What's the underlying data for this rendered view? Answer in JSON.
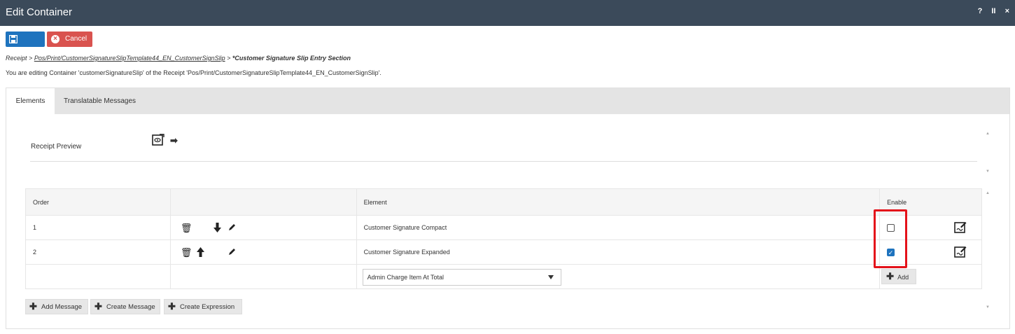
{
  "window": {
    "title": "Edit Container",
    "controls": [
      "?",
      "II",
      "×"
    ]
  },
  "toolbar": {
    "cancel_label": "Cancel"
  },
  "breadcrumb": {
    "root": "Receipt",
    "sep": ">",
    "link": "Pos/Print/CustomerSignatureSlipTemplate44_EN_CustomerSignSlip",
    "current": "*Customer Signature Slip Entry Section"
  },
  "info_text": "You are editing Container 'customerSignatureSlip' of the Receipt 'Pos/Print/CustomerSignatureSlipTemplate44_EN_CustomerSignSlip'.",
  "tabs": [
    {
      "label": "Elements",
      "active": true
    },
    {
      "label": "Translatable Messages",
      "active": false
    }
  ],
  "preview": {
    "label": "Receipt Preview"
  },
  "table": {
    "headers": {
      "order": "Order",
      "actions": "",
      "element": "Element",
      "enable": "Enable"
    },
    "rows": [
      {
        "order": "1",
        "element": "Customer Signature Compact",
        "enabled": false
      },
      {
        "order": "2",
        "element": "Customer Signature Expanded",
        "enabled": true
      }
    ],
    "new_row": {
      "select_value": "Admin Charge Item At Total",
      "add_label": "Add"
    }
  },
  "footer_buttons": [
    "Add Message",
    "Create Message",
    "Create Expression"
  ],
  "colors": {
    "titlebar": "#3b4a5a",
    "save": "#1e73be",
    "cancel": "#d9534f",
    "highlight": "#e4121a"
  },
  "icons": {
    "save": "floppy-disk-icon",
    "cancel": "x-circle-icon",
    "preview": "preview-eye-icon",
    "delete": "trash-icon",
    "move_down": "arrow-down-icon",
    "move_up": "arrow-up-icon",
    "edit": "pencil-icon",
    "edit_sign": "edit-signature-icon",
    "add": "plus-icon"
  }
}
